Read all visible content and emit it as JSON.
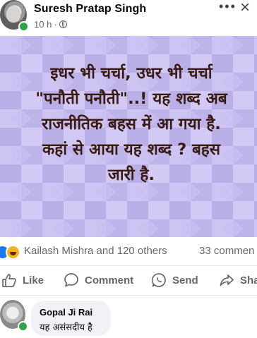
{
  "post": {
    "author": "Suresh Pratap Singh",
    "time": "10 h",
    "separator": "·",
    "more_glyph": "•••",
    "close_glyph": "×",
    "image_lines": [
      "इधर भी चर्चा, उधर भी चर्चा",
      "\"पनौती पनौती\"..! यह शब्द अब",
      "राजनीतिक बहस में आ गया है.",
      "कहां से आया यह शब्द ? बहस",
      "जारी है."
    ],
    "image_background": "#c7bdf0",
    "text_color": "#3a1b12"
  },
  "reactions": {
    "summary": "Kailash Mishra and 120 others",
    "comments": "33 commen",
    "icons": [
      "like-icon",
      "haha-icon"
    ]
  },
  "actions": {
    "like": "Like",
    "comment": "Comment",
    "send": "Send",
    "share": "Shar"
  },
  "comment": {
    "author": "Gopal Ji Rai",
    "text": "यह असंसदीय है"
  },
  "colors": {
    "accent": "#1877f2",
    "online": "#31a24c",
    "muted": "#65676b",
    "bubble": "#f0f2f5"
  }
}
